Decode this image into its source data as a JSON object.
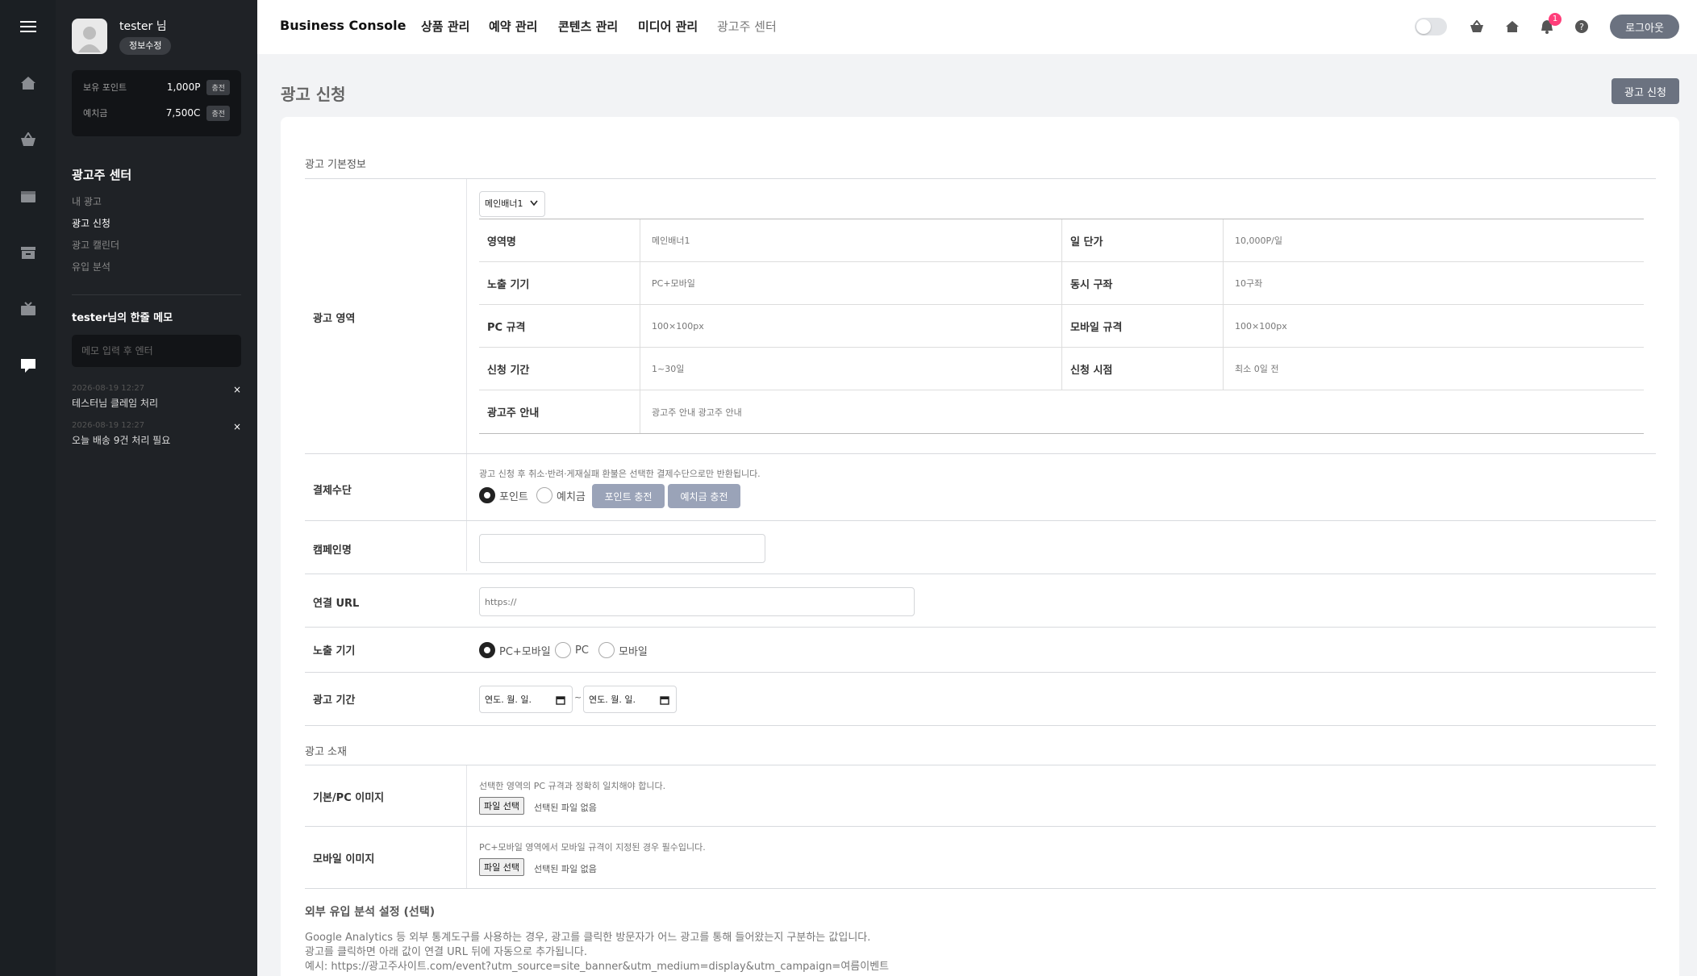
{
  "user": {
    "name": "tester 님",
    "edit_label": "정보수정"
  },
  "points": [
    {
      "label": "보유 포인트",
      "value": "1,000P",
      "charge": "충전"
    },
    {
      "label": "예치금",
      "value": "7,500C",
      "charge": "충전"
    }
  ],
  "sidebar": {
    "title": "광고주 센터",
    "items": [
      "내 광고",
      "광고 신청",
      "광고 캘린더",
      "유입 분석"
    ],
    "active_index": 1
  },
  "memo": {
    "title": "tester님의 한줄 메모",
    "placeholder": "메모 입력 후 엔터",
    "items": [
      {
        "date": "2026-08-19 12:27",
        "text": "테스터님 클레임 처리",
        "close": "×"
      },
      {
        "date": "2026-08-19 12:27",
        "text": "오늘 배송 9건 처리 필요",
        "close": "×"
      }
    ]
  },
  "header": {
    "brand": "Business Console",
    "nav": [
      "상품 관리",
      "예약 관리",
      "콘텐츠 관리",
      "미디어 관리",
      "광고주 센터"
    ],
    "notification_count": "1",
    "logout_label": "로그아웃"
  },
  "page": {
    "title": "광고 신청",
    "apply_label": "광고 신청"
  },
  "form": {
    "section_basic": "광고 기본정보",
    "area_label": "광고 영역",
    "area_select": "메인배너1",
    "area_info": {
      "r1": {
        "k1": "영역명",
        "v1": "메인배너1",
        "k2": "일 단가",
        "v2": "10,000P/일"
      },
      "r2": {
        "k1": "노출 기기",
        "v1": "PC+모바일",
        "k2": "동시 구좌",
        "v2": "10구좌"
      },
      "r3": {
        "k1": "PC 규격",
        "v1": "100×100px",
        "k2": "모바일 규격",
        "v2": "100×100px"
      },
      "r4": {
        "k1": "신청 기간",
        "v1": "1~30일",
        "k2": "신청 시점",
        "v2": "최소 0일 전"
      },
      "r5": {
        "k1": "광고주 안내",
        "v1": "광고주 안내 광고주 안내"
      }
    },
    "payment": {
      "label": "결제수단",
      "help": "광고 신청 후 취소·반려·게재실패 환불은 선택한 결제수단으로만 반환됩니다.",
      "opt1": "포인트",
      "opt2": "예치금",
      "btn_point": "포인트 충전",
      "btn_deposit": "예치금 충전"
    },
    "campaign": {
      "label": "캠페인명",
      "value": ""
    },
    "url": {
      "label": "연결 URL",
      "placeholder": "https://"
    },
    "device": {
      "label": "노출 기기",
      "opt1": "PC+모바일",
      "opt2": "PC",
      "opt3": "모바일"
    },
    "period": {
      "label": "광고 기간",
      "start": "연도. 월. 일.",
      "end": "연도. 월. 일.",
      "sep": "~"
    },
    "section_creative": "광고 소재",
    "pc_image": {
      "label": "기본/PC 이미지",
      "help": "선택한 영역의 PC 규격과 정확히 일치해야 합니다.",
      "btn": "파일 선택",
      "status": "선택된 파일 없음"
    },
    "mobile_image": {
      "label": "모바일 이미지",
      "help": "PC+모바일 영역에서 모바일 규격이 지정된 경우 필수입니다.",
      "btn": "파일 선택",
      "status": "선택된 파일 없음"
    }
  },
  "external": {
    "title": "외부 유입 분석 설정 (선택)",
    "line1": "Google Analytics 등 외부 통계도구를 사용하는 경우, 광고를 클릭한 방문자가 어느 광고를 통해 들어왔는지 구분하는 값입니다.",
    "line2": "광고를 클릭하면 아래 값이 연결 URL 뒤에 자동으로 추가됩니다.",
    "line3": "예시: https://광고주사이트.com/event?utm_source=site_banner&utm_medium=display&utm_campaign=여름이벤트"
  },
  "colors": {
    "sidebar_bg": "#1f2226",
    "accent_gray": "#6b7280",
    "charge_btn": "#9aa3b8",
    "badge": "#ff3e7a"
  }
}
